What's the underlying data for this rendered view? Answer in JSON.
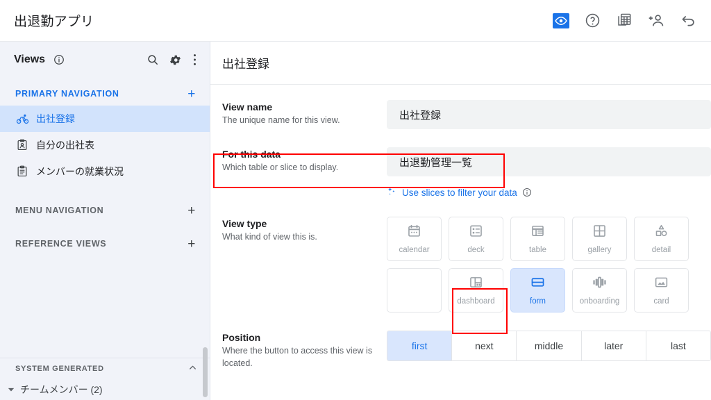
{
  "topbar": {
    "app_title": "出退勤アプリ",
    "actions": [
      {
        "name": "preview-icon",
        "label": "preview",
        "active": true
      },
      {
        "name": "help-icon",
        "label": "help",
        "active": false
      },
      {
        "name": "copy-table-icon",
        "label": "duplicate",
        "active": false
      },
      {
        "name": "add-person-icon",
        "label": "add user",
        "active": false
      },
      {
        "name": "undo-icon",
        "label": "undo",
        "active": false
      }
    ]
  },
  "sidebar": {
    "title": "Views",
    "header_icons": [
      "search-icon",
      "gear-icon",
      "more-vert-icon"
    ],
    "sections": [
      {
        "label": "PRIMARY NAVIGATION",
        "add": "+"
      },
      {
        "label": "MENU NAVIGATION",
        "add": "+"
      },
      {
        "label": "REFERENCE VIEWS",
        "add": "+"
      }
    ],
    "items": [
      {
        "label": "出社登録",
        "icon": "bicycle-icon",
        "selected": true
      },
      {
        "label": "自分の出社表",
        "icon": "clipboard-person-icon",
        "selected": false
      },
      {
        "label": "メンバーの就業状況",
        "icon": "clipboard-list-icon",
        "selected": false
      }
    ],
    "system_generated": {
      "label": "SYSTEM GENERATED",
      "collapse": "^",
      "rows": [
        {
          "label": "チームメンバー (2)"
        }
      ]
    }
  },
  "main": {
    "header_title": "出社登録",
    "fields": {
      "view_name": {
        "title": "View name",
        "subtitle": "The unique name for this view.",
        "value": "出社登録"
      },
      "for_this_data": {
        "title": "For this data",
        "subtitle": "Which table or slice to display.",
        "value": "出退勤管理一覧"
      },
      "view_type": {
        "title": "View type",
        "subtitle": "What kind of view this is."
      },
      "position": {
        "title": "Position",
        "subtitle": "Where the button to access this view is located."
      }
    },
    "slices_link": {
      "label": "Use slices to filter your data",
      "icon": "sparkle-icon",
      "info": "info-icon"
    },
    "view_types": [
      {
        "label": "calendar",
        "icon": "calendar-icon",
        "selected": false
      },
      {
        "label": "deck",
        "icon": "deck-icon",
        "selected": false
      },
      {
        "label": "table",
        "icon": "table-icon",
        "selected": false
      },
      {
        "label": "gallery",
        "icon": "gallery-icon",
        "selected": false
      },
      {
        "label": "detail",
        "icon": "detail-icon",
        "selected": false
      },
      {
        "label": "",
        "icon": "partial-icon",
        "selected": false
      },
      {
        "label": "dashboard",
        "icon": "dashboard-icon",
        "selected": false
      },
      {
        "label": "form",
        "icon": "form-icon",
        "selected": true
      },
      {
        "label": "onboarding",
        "icon": "onboarding-icon",
        "selected": false
      },
      {
        "label": "card",
        "icon": "card-icon",
        "selected": false
      }
    ],
    "positions": [
      {
        "label": "first",
        "selected": true
      },
      {
        "label": "next",
        "selected": false
      },
      {
        "label": "middle",
        "selected": false
      },
      {
        "label": "later",
        "selected": false
      },
      {
        "label": "last",
        "selected": false
      }
    ]
  },
  "colors": {
    "accent": "#1a73e8",
    "selected_bg": "#d2e3fc",
    "sidebar_bg": "#f1f3f9",
    "input_bg": "#f1f3f4",
    "annotation": "#ff0000"
  }
}
